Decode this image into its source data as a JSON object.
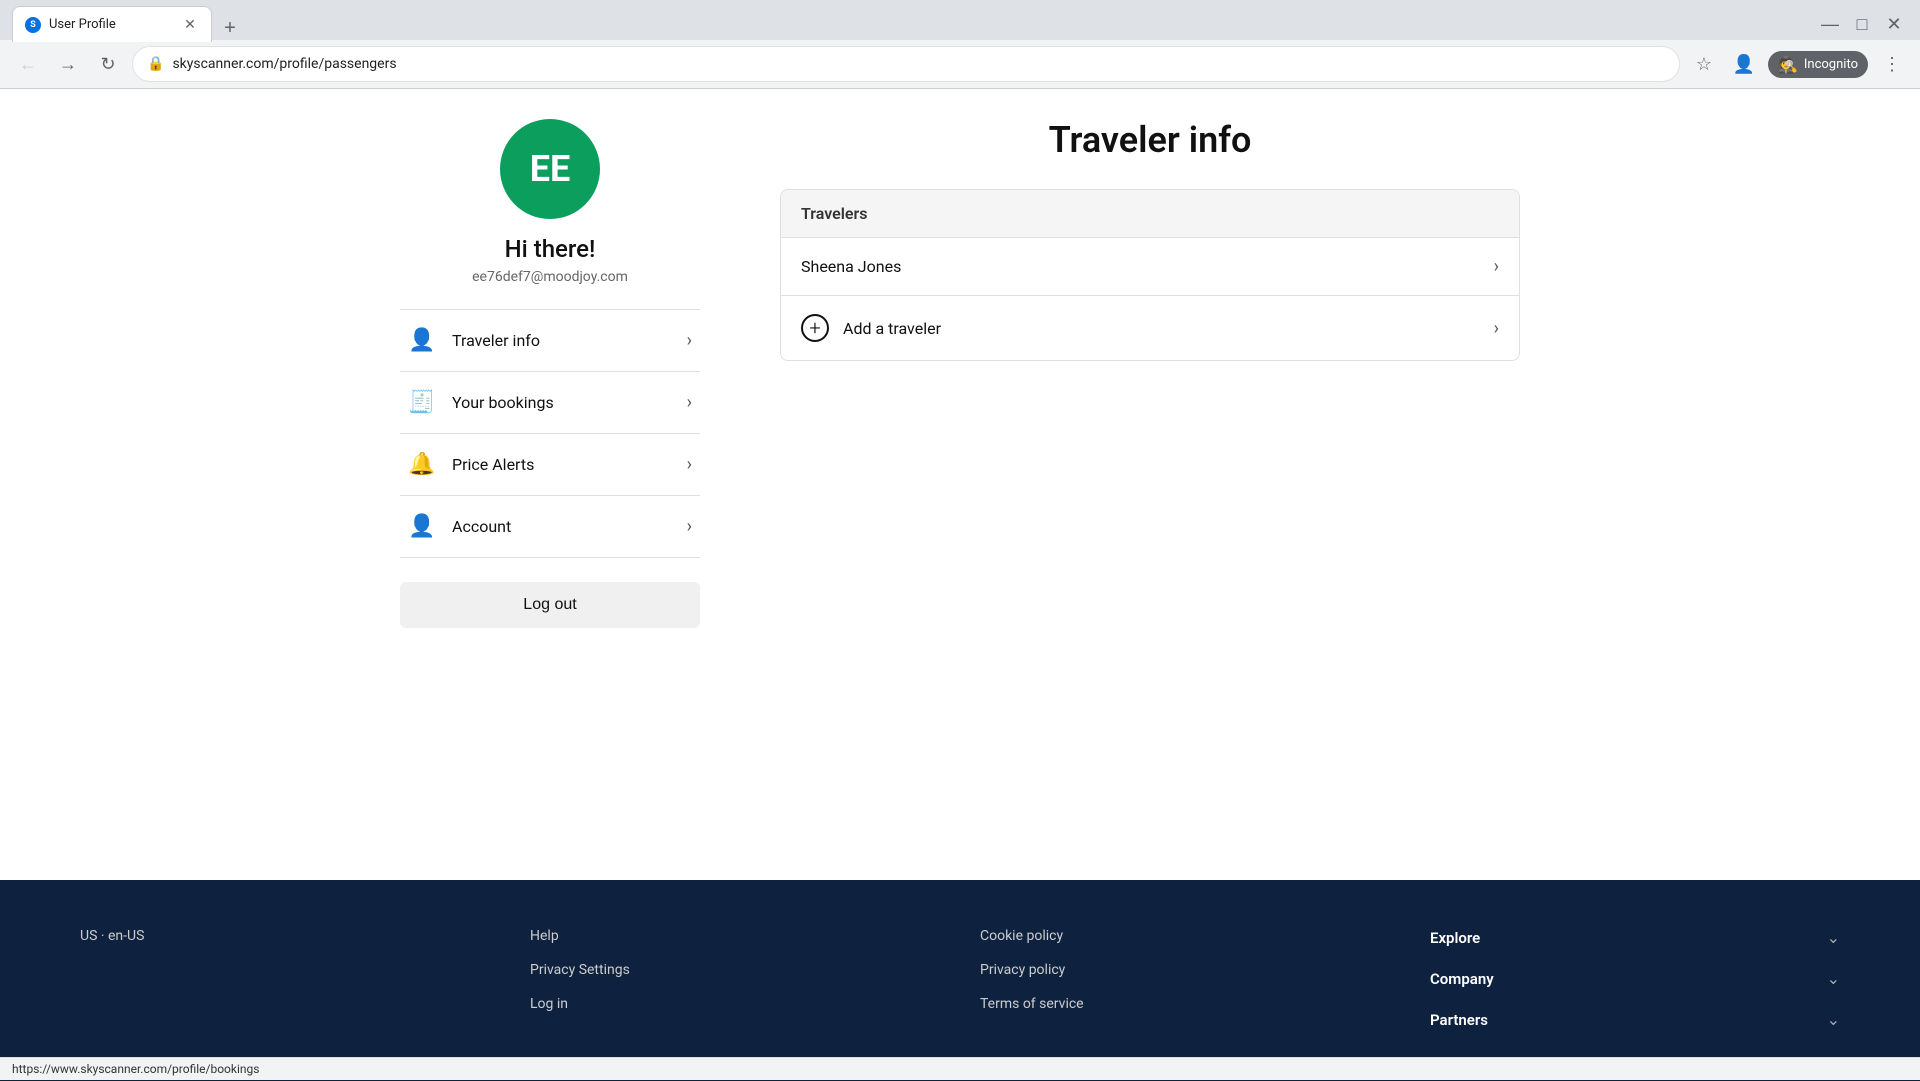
{
  "browser": {
    "tab_title": "User Profile",
    "tab_favicon": "S",
    "url": "skyscanner.com/profile/passengers",
    "incognito_label": "Incognito"
  },
  "user": {
    "initials": "EE",
    "greeting": "Hi there!",
    "email": "ee76def7@moodjoy.com"
  },
  "sidebar_nav": {
    "items": [
      {
        "label": "Traveler info",
        "icon": "👤",
        "id": "traveler-info"
      },
      {
        "label": "Your bookings",
        "icon": "🧾",
        "id": "your-bookings"
      },
      {
        "label": "Price Alerts",
        "icon": "🔔",
        "id": "price-alerts"
      },
      {
        "label": "Account",
        "icon": "👤",
        "id": "account"
      }
    ],
    "logout_label": "Log out"
  },
  "content": {
    "title": "Traveler info",
    "travelers_header": "Travelers",
    "travelers": [
      {
        "name": "Sheena Jones"
      }
    ],
    "add_traveler_label": "Add a traveler"
  },
  "footer": {
    "locale": "US · en-US",
    "col2_links": [
      {
        "label": "Help"
      },
      {
        "label": "Privacy Settings"
      },
      {
        "label": "Log in"
      }
    ],
    "col3_links": [
      {
        "label": "Cookie policy"
      },
      {
        "label": "Privacy policy"
      },
      {
        "label": "Terms of service"
      }
    ],
    "col4_sections": [
      {
        "label": "Explore"
      },
      {
        "label": "Company"
      },
      {
        "label": "Partners"
      }
    ]
  },
  "status_bar": {
    "url": "https://www.skyscanner.com/profile/bookings"
  }
}
